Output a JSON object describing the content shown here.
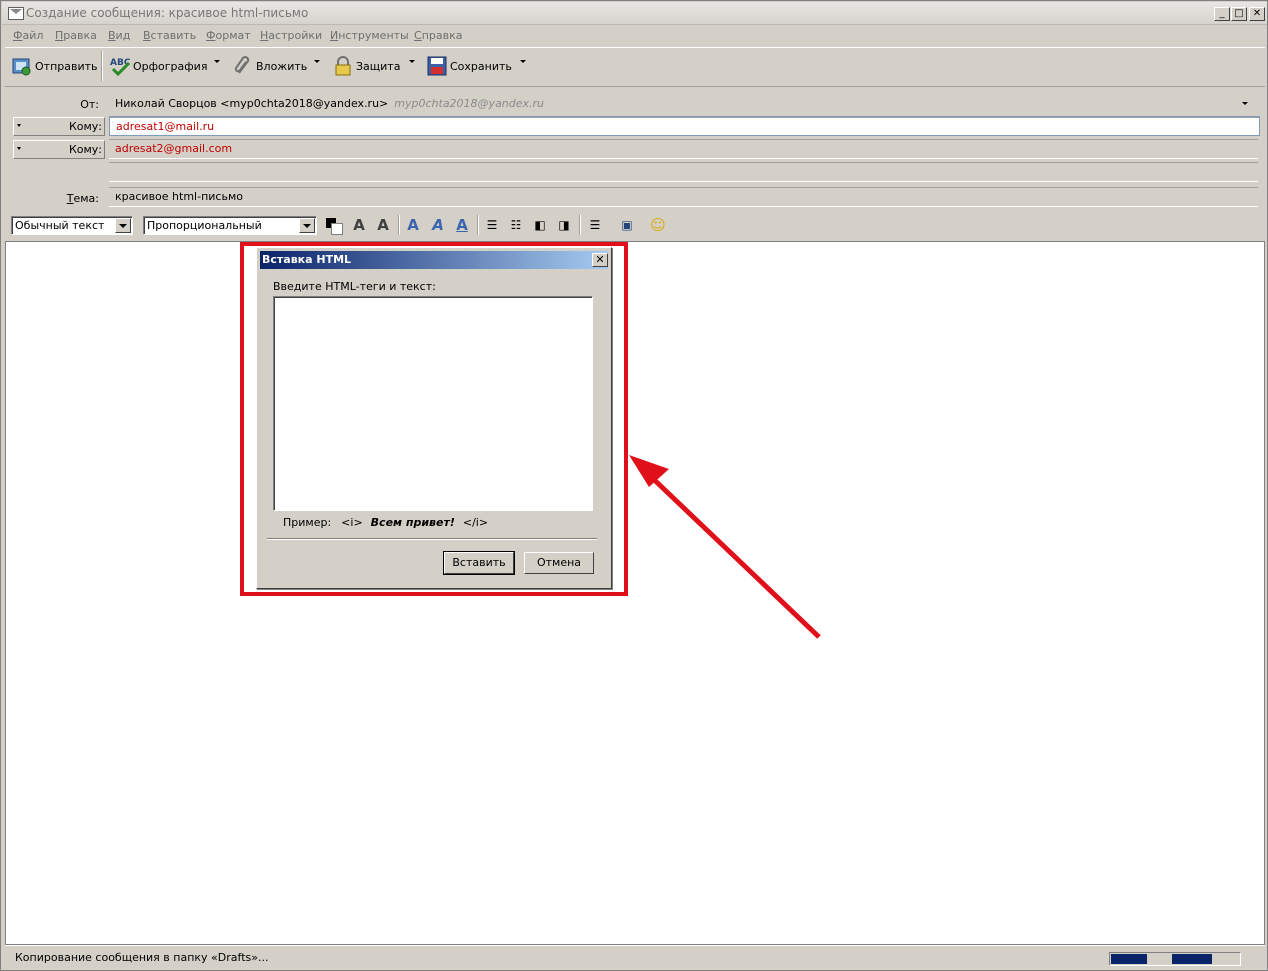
{
  "window": {
    "title": "Создание сообщения: красивое html-письмо",
    "minimize": "_",
    "maximize": "□",
    "close": "✕"
  },
  "menu": [
    {
      "label": "Файл",
      "accel": "Ф",
      "rest": "айл"
    },
    {
      "label": "Правка",
      "accel": "П",
      "rest": "равка"
    },
    {
      "label": "Вид",
      "accel": "В",
      "rest": "ид"
    },
    {
      "label": "Вставить",
      "accel": "В",
      "rest": "ставить"
    },
    {
      "label": "Формат",
      "accel": "Ф",
      "rest": "ормат"
    },
    {
      "label": "Настройки",
      "accel": "Н",
      "rest": "астройки"
    },
    {
      "label": "Инструменты",
      "accel": "И",
      "rest": "нструменты"
    },
    {
      "label": "Справка",
      "accel": "С",
      "rest": "правка"
    }
  ],
  "toolbar": {
    "send": "Отправить",
    "spelling": "Орфография",
    "attach": "Вложить",
    "security": "Защита",
    "save": "Сохранить"
  },
  "headers": {
    "from_label": "От:",
    "from_value": "Николай Сворцов <myp0chta2018@yandex.ru>",
    "from_alt": "myp0chta2018@yandex.ru",
    "to_label": "Кому:",
    "to1": "adresat1@mail.ru",
    "to2": "adresat2@gmail.com",
    "subject_label": "Тема:",
    "subject_value": "красивое html-письмо"
  },
  "format_bar": {
    "paragraph_style": "Обычный текст",
    "font": "Пропорциональный"
  },
  "dialog": {
    "title": "Вставка HTML",
    "prompt": "Введите HTML-теги и текст:",
    "example_label": "Пример:",
    "example_open": "<i>",
    "example_text": "Всем привет!",
    "example_close": "</i>",
    "insert": "Вставить",
    "cancel": "Отмена",
    "close": "✕"
  },
  "status": {
    "text": "Копирование сообщения в папку «Drafts»..."
  },
  "colors": {
    "highlight": "#e0101a",
    "dialog_title": "#0a246a",
    "recipient": "#c00000"
  }
}
